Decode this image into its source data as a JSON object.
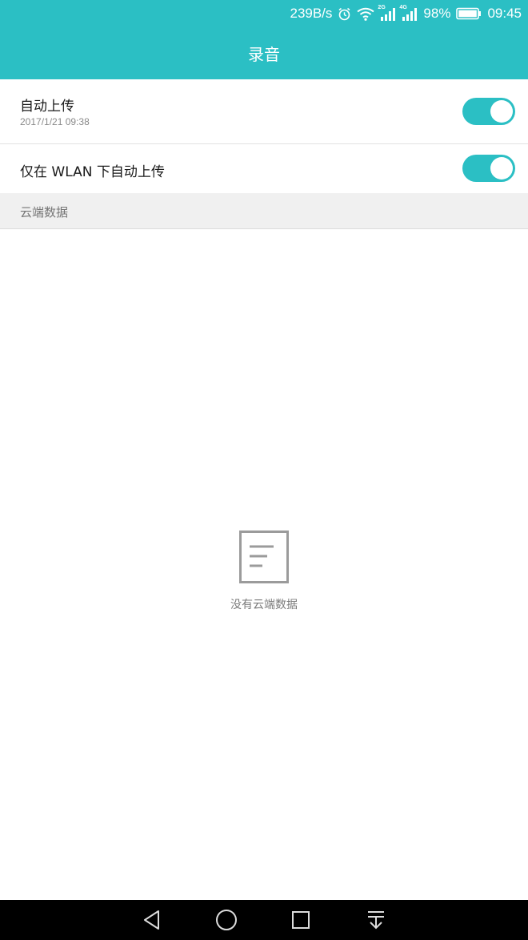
{
  "status_bar": {
    "net_speed": "239B/s",
    "network_2g_tag": "2G",
    "network_4g_tag": "4G",
    "battery_percent": "98%",
    "time": "09:45",
    "icons": [
      "alarm-icon",
      "wifi-icon",
      "signal-icon",
      "signal-icon",
      "battery-icon"
    ]
  },
  "header": {
    "title": "录音"
  },
  "settings": {
    "auto_upload": {
      "label": "自动上传",
      "last_time": "2017/1/21 09:38",
      "enabled": true
    },
    "wlan_only": {
      "label": "仅在 WLAN 下自动上传",
      "enabled": true
    }
  },
  "cloud_section": {
    "header": "云端数据",
    "empty_text": "没有云端数据",
    "empty_icon": "document-icon"
  },
  "nav_bar": {
    "icons": [
      "back-icon",
      "home-icon",
      "recents-icon",
      "notification-pull-icon"
    ]
  },
  "colors": {
    "accent": "#2bbfc4",
    "section_bg": "#f0f0f0",
    "nav_bg": "#000000"
  }
}
